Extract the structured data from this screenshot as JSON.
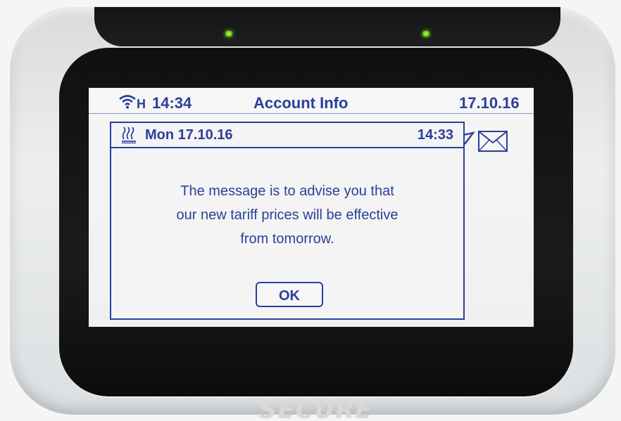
{
  "device": {
    "brand": "SECURE"
  },
  "status_bar": {
    "signal_icon": "wifi-signal-icon",
    "signal_indicator": "H",
    "time": "14:34",
    "title": "Account Info",
    "date": "17.10.16"
  },
  "message": {
    "icon": "heating-icon",
    "header_date": "Mon 17.10.16",
    "header_time": "14:33",
    "body": "The message is to advise you that\nour new tariff prices will be effective\nfrom tomorrow.",
    "ok_label": "OK",
    "envelope_icon": "envelope-icon"
  },
  "colors": {
    "lcd_text": "#2b3f9a",
    "lcd_background": "#f2f2f2",
    "bezel": "#141414",
    "led": "#7fe02a"
  }
}
